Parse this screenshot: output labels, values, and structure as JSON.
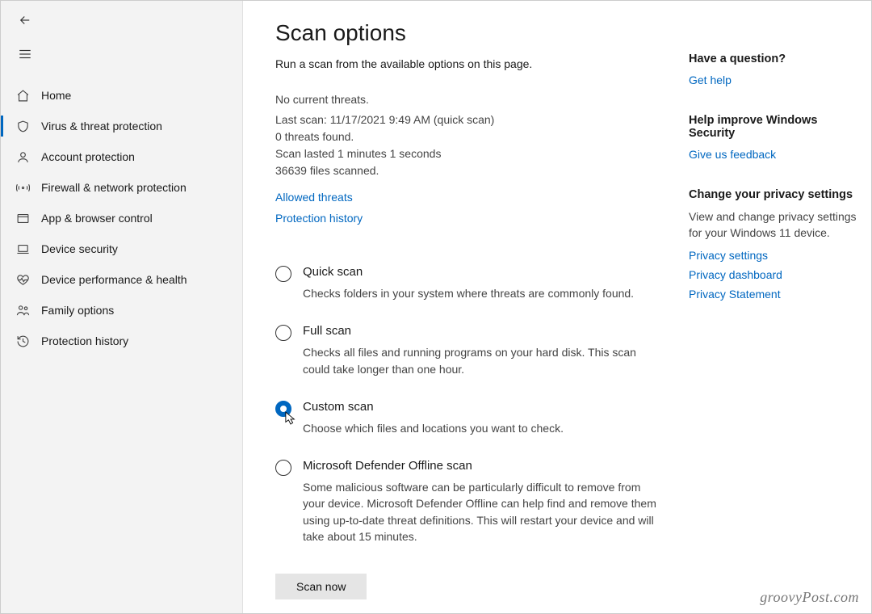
{
  "sidebar": {
    "items": [
      {
        "label": "Home"
      },
      {
        "label": "Virus & threat protection"
      },
      {
        "label": "Account protection"
      },
      {
        "label": "Firewall & network protection"
      },
      {
        "label": "App & browser control"
      },
      {
        "label": "Device security"
      },
      {
        "label": "Device performance & health"
      },
      {
        "label": "Family options"
      },
      {
        "label": "Protection history"
      }
    ],
    "active_index": 1
  },
  "header": {
    "title": "Scan options",
    "subtitle": "Run a scan from the available options on this page."
  },
  "status": {
    "line1": "No current threats.",
    "line2": "Last scan: 11/17/2021 9:49 AM (quick scan)",
    "line3": "0 threats found.",
    "line4": "Scan lasted 1 minutes 1 seconds",
    "line5": "36639 files scanned."
  },
  "status_links": {
    "allowed": "Allowed threats",
    "history": "Protection history"
  },
  "scan_options": [
    {
      "title": "Quick scan",
      "desc": "Checks folders in your system where threats are commonly found."
    },
    {
      "title": "Full scan",
      "desc": "Checks all files and running programs on your hard disk. This scan could take longer than one hour."
    },
    {
      "title": "Custom scan",
      "desc": "Choose which files and locations you want to check."
    },
    {
      "title": "Microsoft Defender Offline scan",
      "desc": "Some malicious software can be particularly difficult to remove from your device. Microsoft Defender Offline can help find and remove them using up-to-date threat definitions. This will restart your device and will take about 15 minutes."
    }
  ],
  "selected_scan_index": 2,
  "scan_button": "Scan now",
  "right": {
    "question": {
      "heading": "Have a question?",
      "link": "Get help"
    },
    "improve": {
      "heading": "Help improve Windows Security",
      "link": "Give us feedback"
    },
    "privacy": {
      "heading": "Change your privacy settings",
      "desc": "View and change privacy settings for your Windows 11 device.",
      "links": [
        "Privacy settings",
        "Privacy dashboard",
        "Privacy Statement"
      ]
    }
  },
  "watermark": "groovyPost.com"
}
